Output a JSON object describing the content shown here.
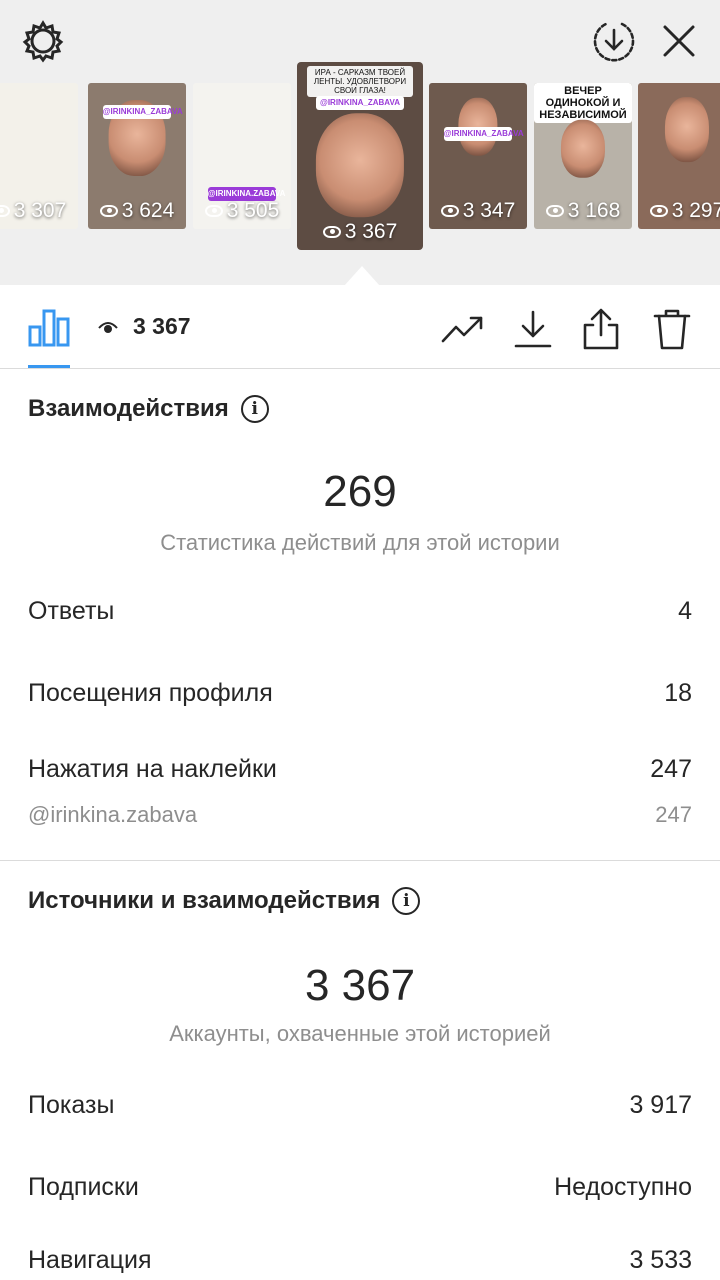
{
  "header": {
    "icons": [
      "gear-icon",
      "download-circle-icon",
      "close-icon"
    ]
  },
  "stories": [
    {
      "views": "3 307",
      "bg": "#f3f1ea"
    },
    {
      "views": "3 624",
      "bg": "#8c7b6e",
      "tag": "@IRINKINA_ZABAVA"
    },
    {
      "views": "3 505",
      "bg": "#f4f3ef",
      "tag": "@IRINKINA.ZABAVA"
    },
    {
      "views": "3 367",
      "bg": "#5d4c43",
      "selected": true,
      "tag": "@IRINKINA_ZABAVA",
      "caption": "ИРА - САРКАЗМ ТВОЕЙ ЛЕНТЫ. УДОВЛЕТВОРИ СВОИ ГЛАЗА!"
    },
    {
      "views": "3 347",
      "bg": "#6e5a4e",
      "tag": "@IRINKINA_ZABAVA"
    },
    {
      "views": "3 168",
      "bg": "#b8b2a8",
      "caption": "ВЕЧЕР ОДИНОКОЙ И НЕЗАВИСИМОЙ"
    },
    {
      "views": "3 297",
      "bg": "#8a6a5a"
    }
  ],
  "actionbar": {
    "views": "3 367",
    "icons": [
      "bar-chart-icon",
      "eye-icon",
      "trend-icon",
      "download-icon",
      "share-icon",
      "trash-icon"
    ]
  },
  "interactions": {
    "title": "Взаимодействия",
    "total": "269",
    "subtitle": "Статистика действий для этой истории",
    "rows": [
      {
        "label": "Ответы",
        "value": "4"
      },
      {
        "label": "Посещения профиля",
        "value": "18"
      },
      {
        "label": "Нажатия на наклейки",
        "value": "247"
      }
    ],
    "sticker": {
      "label": "@irinkina.zabava",
      "value": "247"
    }
  },
  "sources": {
    "title": "Источники и взаимодействия",
    "total": "3 367",
    "subtitle": "Аккаунты, охваченные этой историей",
    "rows": [
      {
        "label": "Показы",
        "value": "3 917"
      },
      {
        "label": "Подписки",
        "value": "Недоступно"
      },
      {
        "label": "Навигация",
        "value": "3 533"
      }
    ]
  },
  "colors": {
    "accent": "#3897f0",
    "text": "#262626",
    "muted": "#8e8e8e",
    "topbg": "#efefef"
  }
}
